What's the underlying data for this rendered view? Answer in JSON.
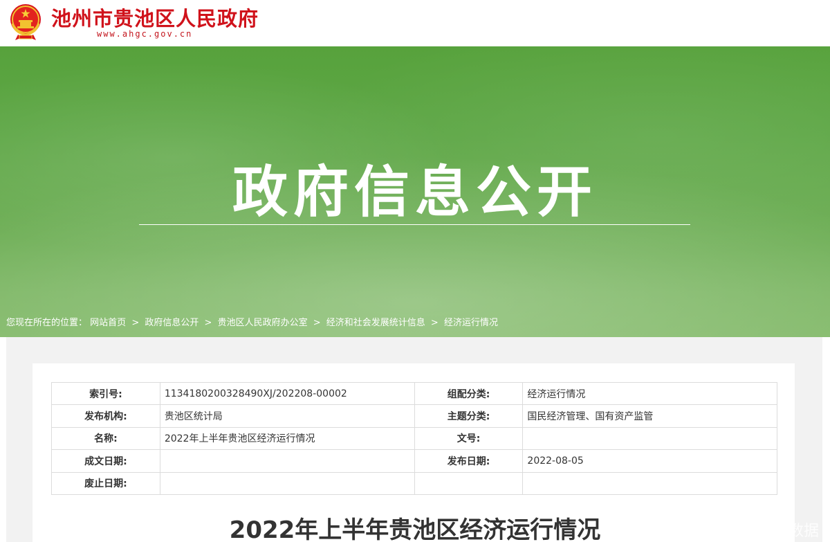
{
  "header": {
    "site_name": "池州市贵池区人民政府",
    "site_url": "www.ahgc.gov.cn"
  },
  "banner": {
    "title": "政府信息公开"
  },
  "breadcrumb": {
    "prefix": "您现在所在的位置：",
    "items": [
      "网站首页",
      "政府信息公开",
      "贵池区人民政府办公室",
      "经济和社会发展统计信息",
      "经济运行情况"
    ],
    "separator": ">"
  },
  "meta": {
    "rows": [
      {
        "k1": "索引号:",
        "v1": "1134180200328490XJ/202208-00002",
        "k2": "组配分类:",
        "v2": "经济运行情况"
      },
      {
        "k1": "发布机构:",
        "v1": "贵池区统计局",
        "k2": "主题分类:",
        "v2": "国民经济管理、国有资产监管"
      },
      {
        "k1": "名称:",
        "v1": "2022年上半年贵池区经济运行情况",
        "k2": "文号:",
        "v2": ""
      },
      {
        "k1": "成文日期:",
        "v1": "",
        "k2": "发布日期:",
        "v2": "2022-08-05"
      },
      {
        "k1": "废止日期:",
        "v1": "",
        "k2": "",
        "v2": ""
      }
    ]
  },
  "article": {
    "title": "2022年上半年贵池区经济运行情况"
  },
  "watermark": "数据",
  "colors": {
    "brand_red": "#d0121b",
    "banner_green": "#5ea746"
  }
}
